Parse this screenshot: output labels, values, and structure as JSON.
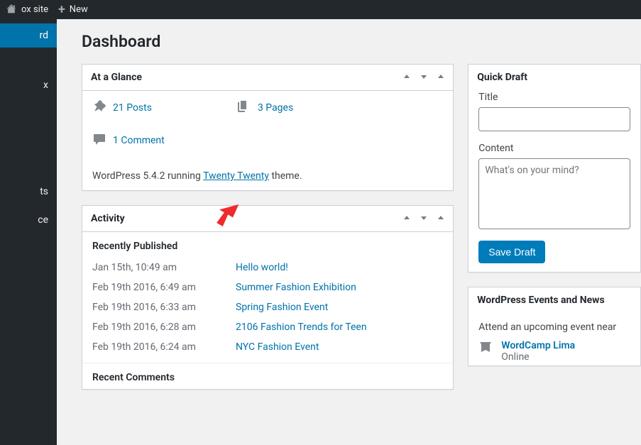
{
  "adminbar": {
    "site_label": "ox site",
    "new_label": "New"
  },
  "sidebar": {
    "items": [
      "rd",
      "",
      "x",
      "",
      "ts",
      "",
      "ce"
    ]
  },
  "page_title": "Dashboard",
  "glance": {
    "title": "At a Glance",
    "posts": "21 Posts",
    "pages": "3 Pages",
    "comments": "1 Comment",
    "version_prefix": "WordPress 5.4.2 running ",
    "theme_link": "Twenty Twenty",
    "version_suffix": " theme."
  },
  "activity": {
    "title": "Activity",
    "recent_pub": "Recently Published",
    "recent_com": "Recent Comments",
    "rows": [
      {
        "date": "Jan 15th, 10:49 am",
        "title": "Hello world!"
      },
      {
        "date": "Feb 19th 2016, 6:49 am",
        "title": "Summer Fashion Exhibition"
      },
      {
        "date": "Feb 19th 2016, 6:33 am",
        "title": "Spring Fashion Event"
      },
      {
        "date": "Feb 19th 2016, 6:28 am",
        "title": "2106 Fashion Trends for Teen"
      },
      {
        "date": "Feb 19th 2016, 6:24 am",
        "title": "NYC Fashion Event"
      }
    ]
  },
  "quickdraft": {
    "title": "Quick Draft",
    "title_label": "Title",
    "content_label": "Content",
    "content_placeholder": "What's on your mind?",
    "save_label": "Save Draft"
  },
  "events": {
    "title": "WordPress Events and News",
    "intro": "Attend an upcoming event near",
    "item": {
      "name": "WordCamp Lima",
      "where": "Online"
    }
  }
}
